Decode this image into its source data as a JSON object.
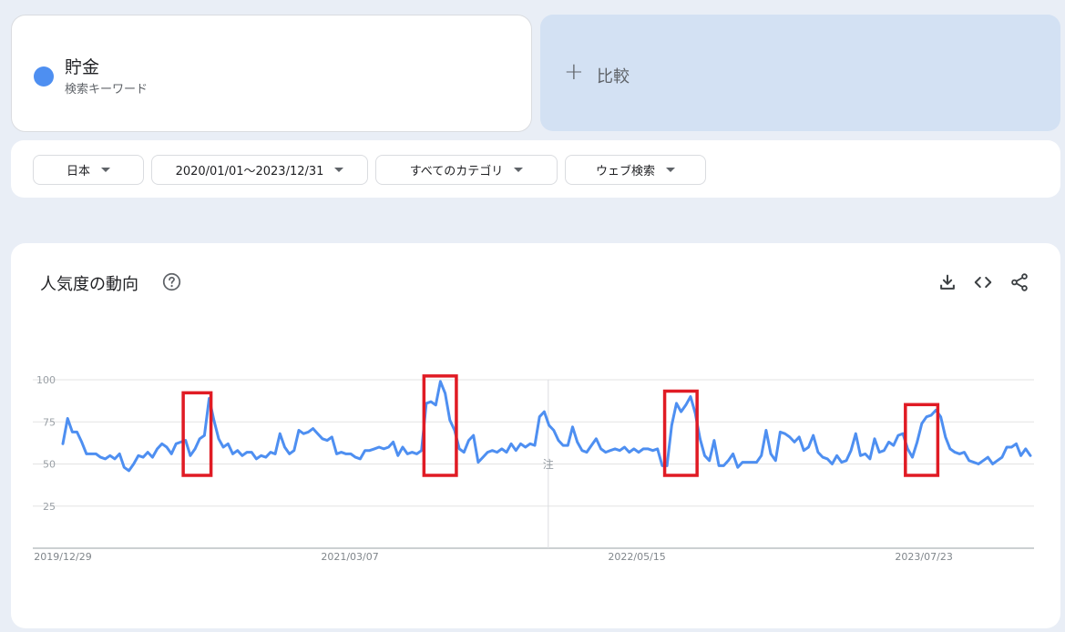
{
  "search_term": {
    "name": "貯金",
    "type": "検索キーワード",
    "color": "#4e8ff1"
  },
  "compare": {
    "plus": "+",
    "label": "比較"
  },
  "filters": [
    {
      "label": "日本"
    },
    {
      "label": "2020/01/01～2023/12/31"
    },
    {
      "label": "すべてのカテゴリ"
    },
    {
      "label": "ウェブ検索"
    }
  ],
  "trend": {
    "title": "人気度の動向",
    "icons": [
      "help-icon",
      "download-icon",
      "embed-icon",
      "share-icon"
    ]
  },
  "chart_data": {
    "type": "line",
    "series": [
      {
        "color": "#4e8ff1",
        "values": [
          62,
          77,
          69,
          69,
          63,
          56,
          56,
          56,
          54,
          53,
          55,
          53,
          56,
          48,
          46,
          50,
          55,
          54,
          57,
          54,
          59,
          62,
          60,
          56,
          62,
          63,
          64,
          55,
          59,
          65,
          67,
          89,
          76,
          65,
          60,
          62,
          56,
          58,
          55,
          57,
          57,
          53,
          55,
          54,
          57,
          56,
          68,
          60,
          56,
          58,
          70,
          68,
          69,
          71,
          68,
          65,
          64,
          66,
          56,
          57,
          56,
          56,
          54,
          53,
          58,
          58,
          59,
          60,
          59,
          60,
          63,
          55,
          60,
          56,
          57,
          56,
          58,
          86,
          87,
          85,
          99,
          92,
          76,
          70,
          59,
          57,
          64,
          67,
          51,
          54,
          57,
          58,
          57,
          59,
          57,
          62,
          58,
          62,
          60,
          62,
          61,
          78,
          81,
          73,
          70,
          64,
          61,
          61,
          72,
          63,
          58,
          57,
          61,
          65,
          59,
          57,
          58,
          59,
          58,
          60,
          57,
          59,
          57,
          59,
          59,
          58,
          59,
          49,
          49,
          73,
          86,
          81,
          85,
          90,
          80,
          65,
          55,
          52,
          64,
          49,
          49,
          52,
          56,
          48,
          51,
          51,
          51,
          51,
          55,
          70,
          56,
          52,
          69,
          68,
          66,
          63,
          66,
          58,
          60,
          67,
          57,
          54,
          53,
          50,
          55,
          51,
          52,
          58,
          68,
          55,
          56,
          53,
          65,
          57,
          58,
          63,
          61,
          67,
          68,
          59,
          54,
          63,
          74,
          78,
          79,
          82,
          78,
          66,
          59,
          57,
          56,
          57,
          52,
          51,
          50,
          52,
          54,
          50,
          52,
          54,
          60,
          60,
          62,
          55,
          59,
          55
        ]
      }
    ],
    "ylim": [
      0,
      100
    ],
    "yticks": [
      25,
      50,
      75,
      100
    ],
    "x_start": "2019/12/29",
    "x_end": "2023/12/31",
    "xtick_labels": [
      "2019/12/29",
      "2021/03/07",
      "2022/05/15",
      "2023/07/23"
    ],
    "annotation_marker": "注",
    "annotation_date": "2022/01/01",
    "highlighted_peaks": [
      {
        "start": "2020/06/28",
        "end": "2020/08/09"
      },
      {
        "start": "2021/06/27",
        "end": "2021/08/15"
      },
      {
        "start": "2022/06/26",
        "end": "2022/08/14"
      },
      {
        "start": "2023/06/25",
        "end": "2023/08/13"
      }
    ],
    "highlight_color": "#e01b24",
    "grid": true
  }
}
